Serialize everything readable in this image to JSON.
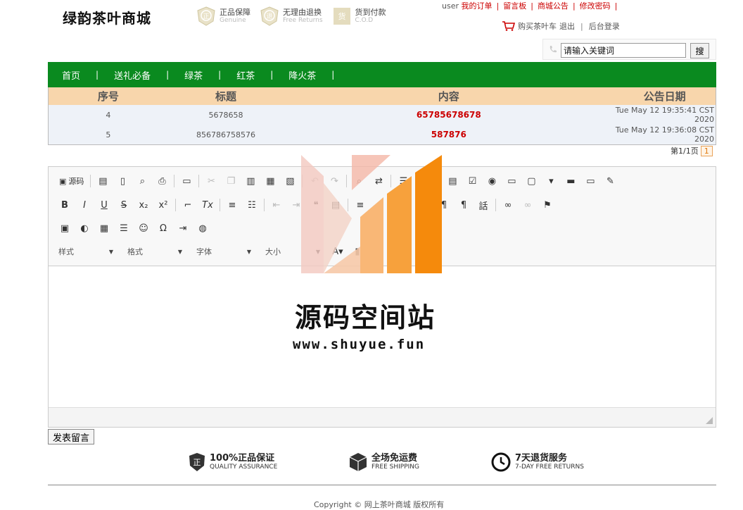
{
  "header": {
    "logo": "绿韵茶叶商城",
    "badges": [
      {
        "icon": "seal-zheng-icon",
        "glyph": "正",
        "title": "正品保障",
        "sub": "Genuine"
      },
      {
        "icon": "seal-tui-icon",
        "glyph": "退",
        "title": "无理由退换",
        "sub": "Free Returns"
      },
      {
        "icon": "seal-huo-icon",
        "glyph": "货",
        "title": "货到付款",
        "sub": "C.O.D"
      }
    ],
    "user": "user",
    "links": [
      "我的订单",
      "留言板",
      "商城公告",
      "修改密码"
    ],
    "cart_label": "购买茶叶车",
    "logout": "退出",
    "admin_login": "后台登录"
  },
  "search": {
    "value": "请输入关键词",
    "button": "搜"
  },
  "nav": [
    "首页",
    "送礼必备",
    "绿茶",
    "红茶",
    "降火茶"
  ],
  "announcements": {
    "headers": [
      "序号",
      "标题",
      "内容",
      "公告日期"
    ],
    "rows": [
      {
        "id": "4",
        "title": "5678658",
        "content": "65785678678",
        "date": "Tue May 12 19:35:41 CST 2020"
      },
      {
        "id": "5",
        "title": "856786758576",
        "content": "587876",
        "date": "Tue May 12 19:36:08 CST 2020"
      }
    ]
  },
  "pager": {
    "text": "第1/1页",
    "current": "1"
  },
  "editor": {
    "source_label": "源码",
    "combos": [
      "样式",
      "格式",
      "字体",
      "大小"
    ]
  },
  "submit_label": "发表留言",
  "watermark": {
    "title": "源码空间站",
    "url": "www.shuyue.fun"
  },
  "footer": {
    "features": [
      {
        "icon": "shield-icon",
        "title": "100%正品保证",
        "sub": "QUALITY ASSURANCE"
      },
      {
        "icon": "box-icon",
        "title": "全场免运费",
        "sub": "FREE SHIPPING"
      },
      {
        "icon": "clock-icon",
        "title": "7天退货服务",
        "sub": "7-DAY FREE RETURNS"
      }
    ],
    "copyright": "Copyright © 网上茶叶商城 版权所有"
  },
  "colors": {
    "nav_green": "#0a8a1f",
    "table_header": "#f8d6ac",
    "link_red": "#cc0000",
    "accent_orange": "#f7931e"
  }
}
